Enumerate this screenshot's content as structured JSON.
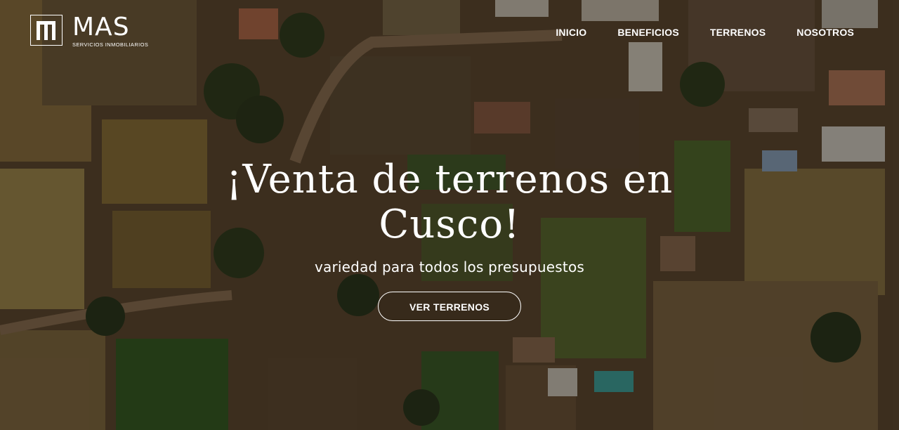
{
  "brand": {
    "name": "MAS",
    "tagline": "SERVICIOS INMOBILIARIOS"
  },
  "nav": {
    "items": [
      {
        "label": "INICIO"
      },
      {
        "label": "BENEFICIOS"
      },
      {
        "label": "TERRENOS"
      },
      {
        "label": "NOSOTROS"
      }
    ]
  },
  "hero": {
    "title": "¡Venta de terrenos en Cusco!",
    "subtitle": "variedad para todos los presupuestos",
    "cta_label": "VER TERRENOS"
  },
  "colors": {
    "text": "#ffffff",
    "overlay": "#140e08",
    "earth": "#6b5238",
    "field": "#8a7a3e",
    "grass": "#3d6a2a"
  }
}
